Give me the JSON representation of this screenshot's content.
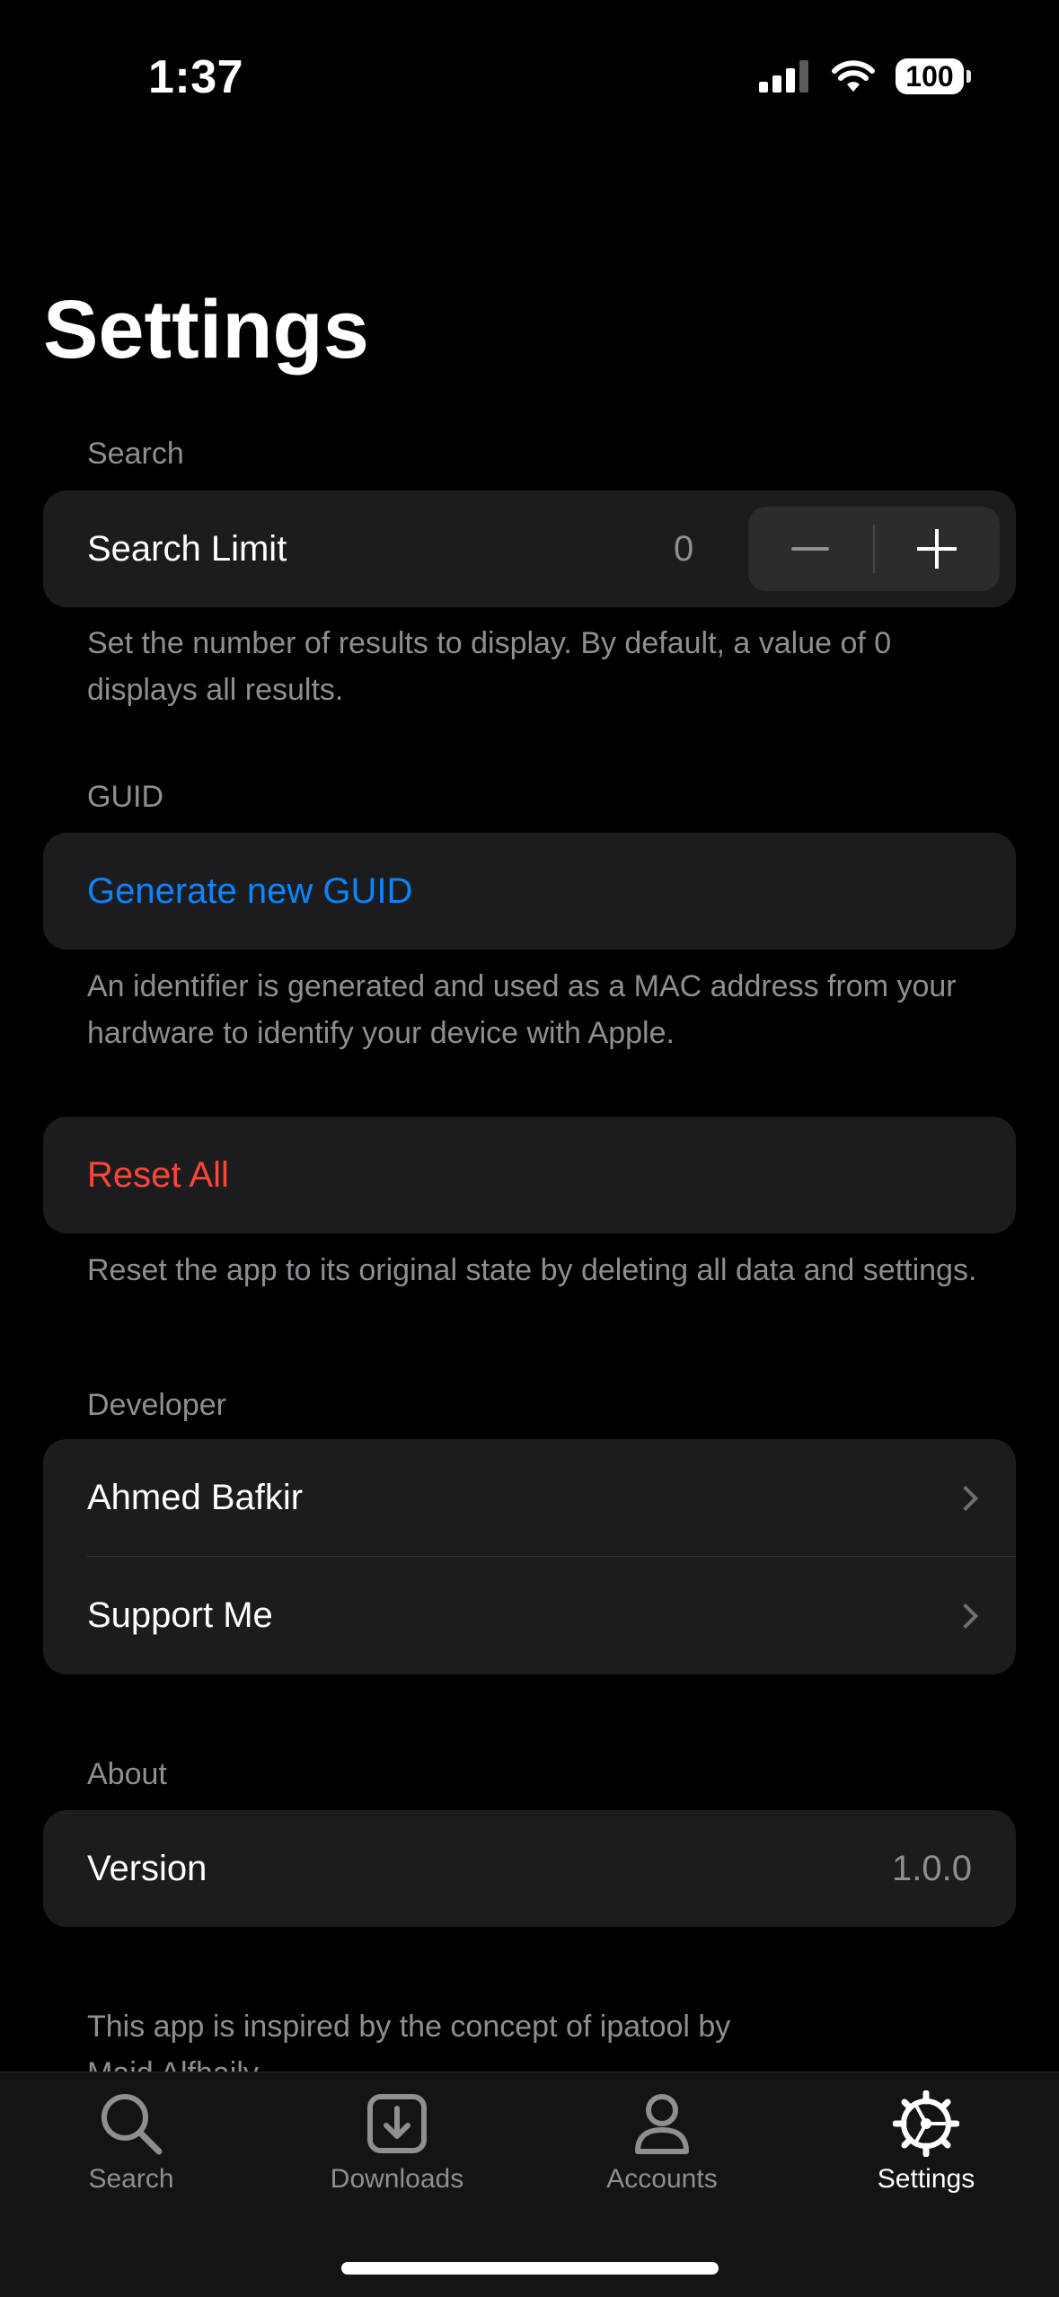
{
  "status_bar": {
    "time": "1:37",
    "battery": "100",
    "icons": [
      "cellular-signal-icon",
      "wifi-icon",
      "battery-icon"
    ]
  },
  "page_title": "Settings",
  "search_section": {
    "header": "Search",
    "row_label": "Search Limit",
    "value": "0",
    "decrement": "−",
    "increment": "+",
    "footer": "Set the number of results to display. By default, a value of 0 displays all results."
  },
  "guid_section": {
    "header": "GUID",
    "action_label": "Generate new GUID",
    "footer": "An identifier is generated and used as a MAC address from your hardware to identify your device with Apple."
  },
  "reset_section": {
    "action_label": "Reset All",
    "footer": "Reset the app to its original state by deleting all data and settings."
  },
  "developer_section": {
    "header": "Developer",
    "items": [
      {
        "label": "Ahmed Bafkir"
      },
      {
        "label": "Support Me"
      }
    ]
  },
  "about_section": {
    "header": "About",
    "row_label": "Version",
    "value": "1.0.0",
    "footer_line1": "This app is inspired by the concept of ipatool by",
    "footer_line2": "Majd Alfhaily"
  },
  "tab_bar": {
    "tabs": [
      {
        "label": "Search",
        "icon": "magnifier-icon"
      },
      {
        "label": "Downloads",
        "icon": "download-icon"
      },
      {
        "label": "Accounts",
        "icon": "person-icon"
      },
      {
        "label": "Settings",
        "icon": "gear-icon",
        "active": true
      }
    ]
  },
  "colors": {
    "background": "#000000",
    "card": "#1c1c1e",
    "link_blue": "#0a84ff",
    "destructive_red": "#ff453a",
    "secondary_text": "#8e8e93"
  }
}
